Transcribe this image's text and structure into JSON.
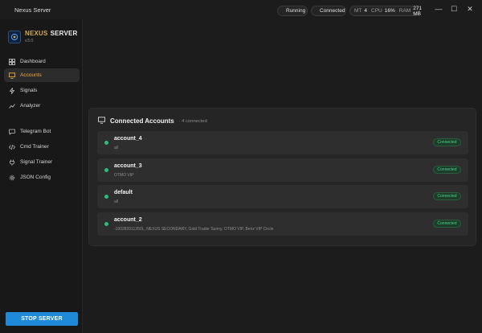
{
  "window": {
    "title": "Nexus Server",
    "status_running": "Running",
    "status_connected": "Connected",
    "stats": [
      {
        "label": "MT",
        "value": "4"
      },
      {
        "label": "CPU",
        "value": "16%"
      },
      {
        "label": "RAM",
        "value": "271 MB"
      }
    ],
    "controls": {
      "minimize": "—",
      "maximize": "☐",
      "close": "✕"
    }
  },
  "sidebar": {
    "brand_a": "NEXUS",
    "brand_b": "SERVER",
    "version": "v3.0",
    "items": [
      {
        "label": "Dashboard",
        "icon": "grid-icon"
      },
      {
        "label": "Accounts",
        "icon": "monitor-icon",
        "active": true
      },
      {
        "label": "Signals",
        "icon": "bolt-icon"
      },
      {
        "label": "Analyzer",
        "icon": "chart-icon"
      },
      {
        "label": "Telegram Bot",
        "icon": "chat-icon"
      },
      {
        "label": "Cmd Trainer",
        "icon": "code-icon"
      },
      {
        "label": "Signal Trainer",
        "icon": "plug-icon"
      },
      {
        "label": "JSON Config",
        "icon": "gear-icon"
      }
    ],
    "stop_button": "STOP SERVER"
  },
  "panel": {
    "title": "Connected Accounts",
    "subtitle": "· 4 connected",
    "accounts": [
      {
        "name": "account_4",
        "sub": "all",
        "status": "Connected"
      },
      {
        "name": "account_3",
        "sub": "OTMO VIP",
        "status": "Connected"
      },
      {
        "name": "default",
        "sub": "all",
        "status": "Connected"
      },
      {
        "name": "account_2",
        "sub": "-100282011350L, NEXUS SECONDARY, Gold Trader Sunny, OTMO VIP, Benz VIP Circle",
        "status": "Connected"
      }
    ]
  },
  "colors": {
    "accent": "#f0a93a",
    "status_green": "#27c07a",
    "stop_button": "#1e8ad8"
  }
}
